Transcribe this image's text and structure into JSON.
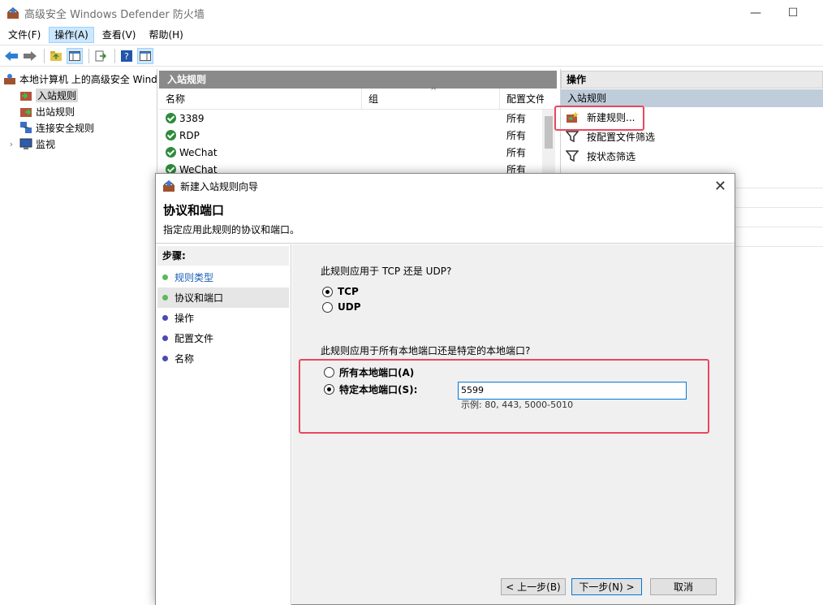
{
  "window": {
    "title": "高级安全 Windows Defender 防火墙",
    "minimize": "—",
    "maximize": "☐"
  },
  "menu": [
    "文件(F)",
    "操作(A)",
    "查看(V)",
    "帮助(H)"
  ],
  "tree": {
    "root": "本地计算机 上的高级安全 Windows Defender 防火墙",
    "items": [
      "入站规则",
      "出站规则",
      "连接安全规则",
      "监视"
    ]
  },
  "center": {
    "header": "入站规则",
    "columns": [
      "名称",
      "组",
      "配置文件"
    ],
    "rows": [
      {
        "name": "3389",
        "group": "",
        "profile": "所有"
      },
      {
        "name": "RDP",
        "group": "",
        "profile": "所有"
      },
      {
        "name": "WeChat",
        "group": "",
        "profile": "所有"
      },
      {
        "name": "WeChat",
        "group": "",
        "profile": "所有"
      }
    ]
  },
  "actions": {
    "header": "操作",
    "section": "入站规则",
    "items": [
      "新建规则...",
      "按配置文件筛选",
      "按状态筛选"
    ]
  },
  "dialog": {
    "title": "新建入站规则向导",
    "close": "✕",
    "heading": "协议和端口",
    "subheading": "指定应用此规则的协议和端口。",
    "steps_title": "步骤:",
    "steps": [
      "规则类型",
      "协议和端口",
      "操作",
      "配置文件",
      "名称"
    ],
    "q1": "此规则应用于 TCP 还是 UDP?",
    "protocol_options": [
      "TCP",
      "UDP"
    ],
    "q2": "此规则应用于所有本地端口还是特定的本地端口?",
    "port_options": [
      "所有本地端口(A)",
      "特定本地端口(S):"
    ],
    "port_value": "5599",
    "port_hint": "示例: 80, 443, 5000-5010",
    "buttons": {
      "back": "< 上一步(B)",
      "next": "下一步(N) >",
      "cancel": "取消"
    }
  },
  "colors": {
    "highlight": "#e8475f",
    "step_done": "#5cb85c",
    "step_pending": "#4a4ab0"
  }
}
